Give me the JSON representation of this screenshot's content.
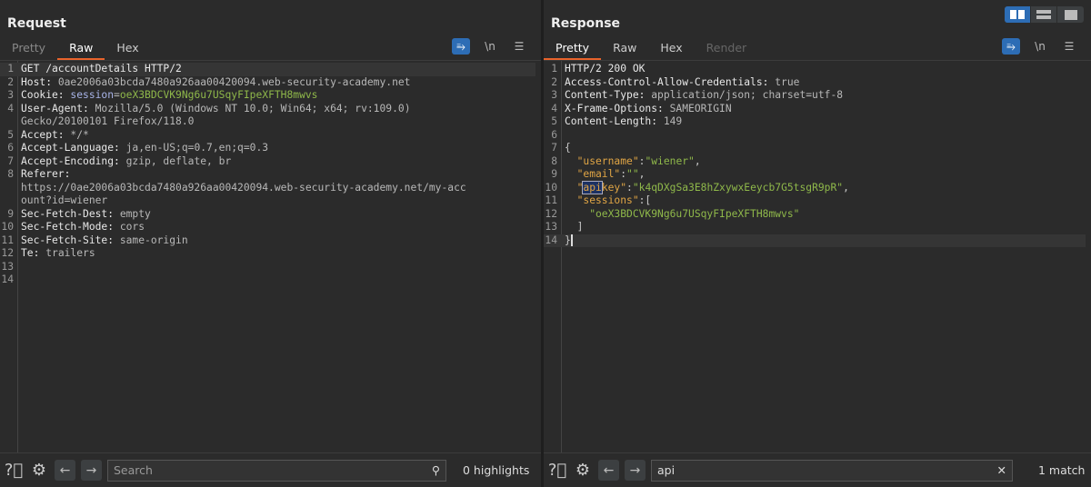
{
  "request": {
    "title": "Request",
    "tabs": [
      "Pretty",
      "Raw",
      "Hex"
    ],
    "active_tab": 1,
    "lines": [
      {
        "n": "1",
        "seg": [
          {
            "t": "GET /accountDetails HTTP/2",
            "c": "h"
          }
        ],
        "cur": true
      },
      {
        "n": "2",
        "seg": [
          {
            "t": "Host: ",
            "c": "h"
          },
          {
            "t": "0ae2006a03bcda7480a926aa00420094.web-security-academy.net",
            "c": "v"
          }
        ]
      },
      {
        "n": "3",
        "seg": [
          {
            "t": "Cookie: ",
            "c": "h"
          },
          {
            "t": "session",
            "c": "ck"
          },
          {
            "t": "=",
            "c": "v"
          },
          {
            "t": "oeX3BDCVK9Ng6u7USqyFIpeXFTH8mwvs",
            "c": "cv"
          }
        ]
      },
      {
        "n": "4",
        "seg": [
          {
            "t": "User-Agent: ",
            "c": "h"
          },
          {
            "t": "Mozilla/5.0 (Windows NT 10.0; Win64; x64; rv:109.0)",
            "c": "v"
          }
        ]
      },
      {
        "n": "",
        "seg": [
          {
            "t": "Gecko/20100101 Firefox/118.0",
            "c": "v"
          }
        ]
      },
      {
        "n": "5",
        "seg": [
          {
            "t": "Accept: ",
            "c": "h"
          },
          {
            "t": "*/*",
            "c": "v"
          }
        ]
      },
      {
        "n": "6",
        "seg": [
          {
            "t": "Accept-Language: ",
            "c": "h"
          },
          {
            "t": "ja,en-US;q=0.7,en;q=0.3",
            "c": "v"
          }
        ]
      },
      {
        "n": "7",
        "seg": [
          {
            "t": "Accept-Encoding: ",
            "c": "h"
          },
          {
            "t": "gzip, deflate, br",
            "c": "v"
          }
        ]
      },
      {
        "n": "8",
        "seg": [
          {
            "t": "Referer: ",
            "c": "h"
          }
        ]
      },
      {
        "n": "",
        "seg": [
          {
            "t": "https://0ae2006a03bcda7480a926aa00420094.web-security-academy.net/my-acc",
            "c": "v"
          }
        ]
      },
      {
        "n": "",
        "seg": [
          {
            "t": "ount?id=wiener",
            "c": "v"
          }
        ]
      },
      {
        "n": "9",
        "seg": [
          {
            "t": "Sec-Fetch-Dest: ",
            "c": "h"
          },
          {
            "t": "empty",
            "c": "v"
          }
        ]
      },
      {
        "n": "10",
        "seg": [
          {
            "t": "Sec-Fetch-Mode: ",
            "c": "h"
          },
          {
            "t": "cors",
            "c": "v"
          }
        ]
      },
      {
        "n": "11",
        "seg": [
          {
            "t": "Sec-Fetch-Site: ",
            "c": "h"
          },
          {
            "t": "same-origin",
            "c": "v"
          }
        ]
      },
      {
        "n": "12",
        "seg": [
          {
            "t": "Te: ",
            "c": "h"
          },
          {
            "t": "trailers",
            "c": "v"
          }
        ]
      },
      {
        "n": "13",
        "seg": []
      },
      {
        "n": "14",
        "seg": []
      }
    ],
    "search": {
      "placeholder": "Search",
      "value": ""
    },
    "count": "0 highlights"
  },
  "response": {
    "title": "Response",
    "tabs": [
      "Pretty",
      "Raw",
      "Hex",
      "Render"
    ],
    "active_tab": 0,
    "lines": [
      {
        "n": "1",
        "seg": [
          {
            "t": "HTTP/2 200 OK",
            "c": "h"
          }
        ]
      },
      {
        "n": "2",
        "seg": [
          {
            "t": "Access-Control-Allow-Credentials: ",
            "c": "h"
          },
          {
            "t": "true",
            "c": "v"
          }
        ]
      },
      {
        "n": "3",
        "seg": [
          {
            "t": "Content-Type: ",
            "c": "h"
          },
          {
            "t": "application/json; charset=utf-8",
            "c": "v"
          }
        ]
      },
      {
        "n": "4",
        "seg": [
          {
            "t": "X-Frame-Options: ",
            "c": "h"
          },
          {
            "t": "SAMEORIGIN",
            "c": "v"
          }
        ]
      },
      {
        "n": "5",
        "seg": [
          {
            "t": "Content-Length: ",
            "c": "h"
          },
          {
            "t": "149",
            "c": "v"
          }
        ]
      },
      {
        "n": "6",
        "seg": []
      },
      {
        "n": "7",
        "seg": [
          {
            "t": "{",
            "c": "p"
          }
        ]
      },
      {
        "n": "8",
        "seg": [
          {
            "t": "  \"username\"",
            "c": "k"
          },
          {
            "t": ":",
            "c": "p"
          },
          {
            "t": "\"wiener\"",
            "c": "s"
          },
          {
            "t": ",",
            "c": "p"
          }
        ]
      },
      {
        "n": "9",
        "seg": [
          {
            "t": "  \"email\"",
            "c": "k"
          },
          {
            "t": ":",
            "c": "p"
          },
          {
            "t": "\"\"",
            "c": "s"
          },
          {
            "t": ",",
            "c": "p"
          }
        ]
      },
      {
        "n": "10",
        "seg": [
          {
            "t": "  \"",
            "c": "k"
          },
          {
            "t": "api",
            "c": "k hl"
          },
          {
            "t": "key\"",
            "c": "k"
          },
          {
            "t": ":",
            "c": "p"
          },
          {
            "t": "\"k4qDXgSa3E8hZxywxEeycb7G5tsgR9pR\"",
            "c": "s"
          },
          {
            "t": ",",
            "c": "p"
          }
        ]
      },
      {
        "n": "11",
        "seg": [
          {
            "t": "  \"sessions\"",
            "c": "k"
          },
          {
            "t": ":[",
            "c": "p"
          }
        ]
      },
      {
        "n": "12",
        "seg": [
          {
            "t": "    \"oeX3BDCVK9Ng6u7USqyFIpeXFTH8mwvs\"",
            "c": "s"
          }
        ]
      },
      {
        "n": "13",
        "seg": [
          {
            "t": "  ]",
            "c": "p"
          }
        ]
      },
      {
        "n": "14",
        "seg": [
          {
            "t": "}",
            "c": "p"
          }
        ],
        "cur": true,
        "caret": true
      }
    ],
    "search": {
      "placeholder": "Search",
      "value": "api"
    },
    "count": "1 match"
  },
  "toolbar": {
    "newline_label": "\\n"
  },
  "colors": {
    "accent": "#e8632b",
    "active_blue": "#2d6db5"
  }
}
